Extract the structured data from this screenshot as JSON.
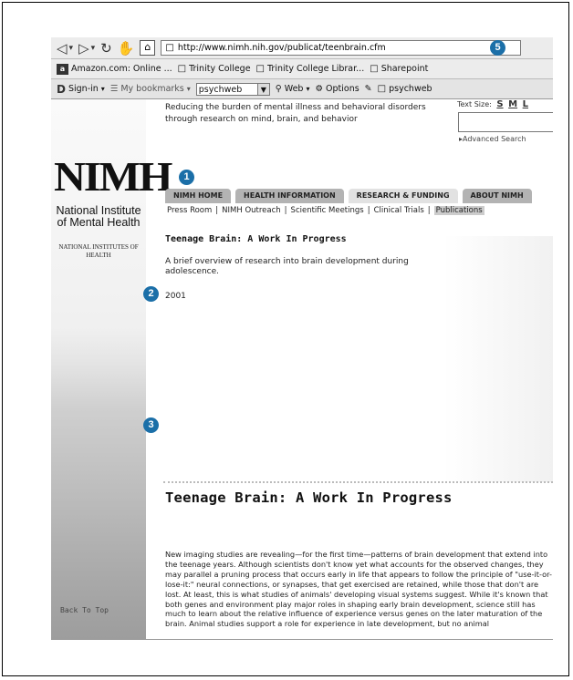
{
  "browser": {
    "url": "http://www.nimh.nih.gov/publicat/teenbrain.cfm",
    "nav_icons": [
      "back-icon",
      "forward-icon",
      "refresh-icon",
      "stop-icon",
      "home-icon"
    ],
    "bookmarks": [
      {
        "label": "Amazon.com: Online ...",
        "icon": "amazon-icon"
      },
      {
        "label": "Trinity College",
        "icon": "page-icon"
      },
      {
        "label": "Trinity College Librar...",
        "icon": "page-icon"
      },
      {
        "label": "Sharepoint",
        "icon": "page-icon"
      }
    ],
    "toolbar3": {
      "signin": "Sign-in",
      "mybookmarks": "My bookmarks",
      "search_value": "psychweb",
      "web": "Web",
      "options": "Options",
      "psychweb": "psychweb"
    }
  },
  "page": {
    "tagline": "Reducing the burden of mental illness and behavioral disorders through research on mind, brain, and behavior",
    "text_size": {
      "label": "Text Size:",
      "options": [
        "S",
        "M",
        "L"
      ]
    },
    "advanced_search": "▸Advanced Search",
    "logo": "NIMH",
    "institute": "National Institute of Mental Health",
    "parent": "NATIONAL INSTITUTES OF HEALTH",
    "tabs": [
      {
        "label": "NIMH HOME"
      },
      {
        "label": "HEALTH INFORMATION"
      },
      {
        "label": "RESEARCH & FUNDING"
      },
      {
        "label": "ABOUT NIMH"
      }
    ],
    "subnav": [
      "Press Room",
      "NIMH Outreach",
      "Scientific Meetings",
      "Clinical Trials",
      "Publications"
    ],
    "title_small": "Teenage Brain: A Work In Progress",
    "description": "A brief overview of research into brain development during adolescence.",
    "year": "2001",
    "title_big": "Teenage Brain: A Work In Progress",
    "body": "New imaging studies are revealing—for the first time—patterns of brain development that extend into the teenage years. Although scientists don't know yet what accounts for the observed changes, they may parallel a pruning process that occurs early in life that appears to follow the principle of \"use-it-or-lose-it:\" neural connections, or synapses, that get exercised are retained, while those that don't are lost. At least, this is what studies of animals' developing visual systems suggest. While it's known that both genes and environment play major roles in shaping early brain development, science still has much to learn about the relative influence of experience versus genes on the later maturation of the brain. Animal studies support a role for experience in late development, but no animal",
    "back_to_top": "Back To Top"
  },
  "markers": [
    "1",
    "2",
    "3",
    "5"
  ],
  "colors": {
    "marker": "#1b6fa8"
  }
}
